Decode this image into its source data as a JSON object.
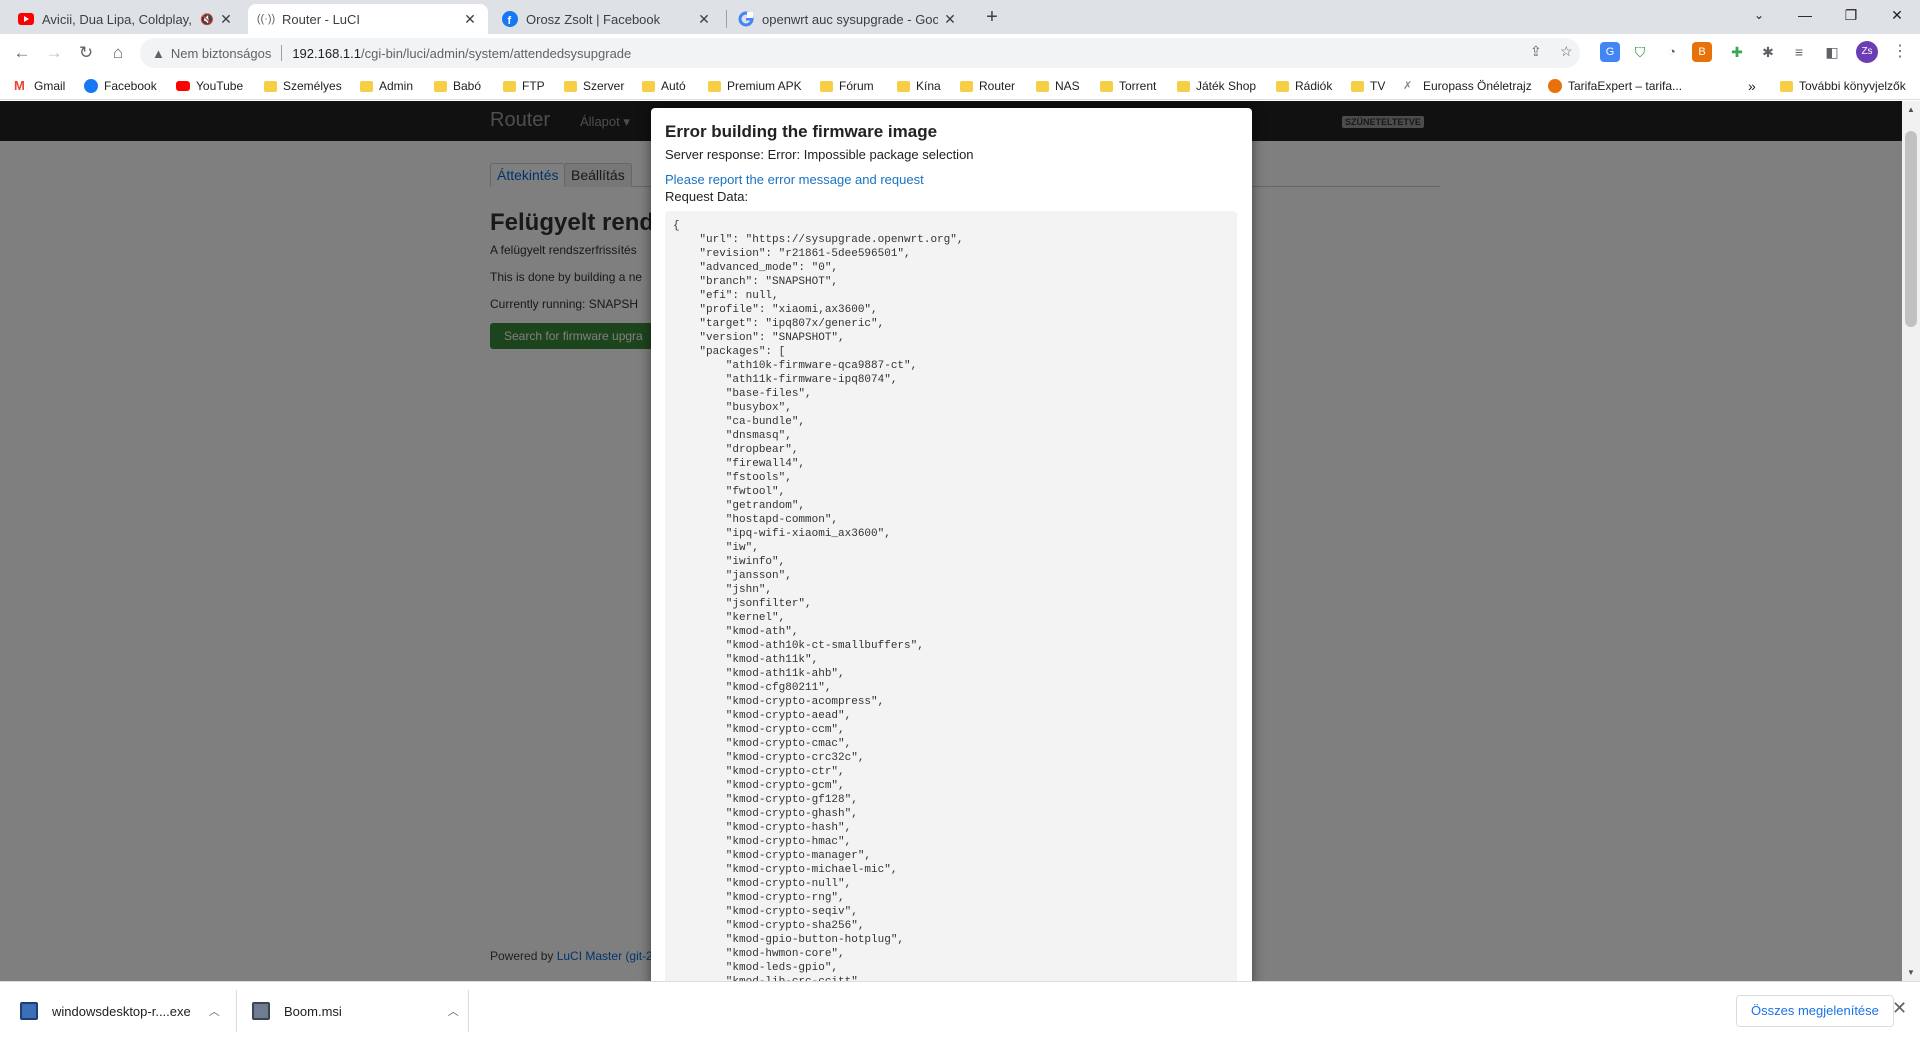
{
  "tabs": [
    {
      "title": "Avicii, Dua Lipa, Coldplay, Ma",
      "favicon": "youtube-icon",
      "muted": true
    },
    {
      "title": "Router - LuCI",
      "favicon": "radio-signal-icon",
      "active": true
    },
    {
      "title": "Orosz Zsolt | Facebook",
      "favicon": "facebook-icon"
    },
    {
      "title": "openwrt auc sysupgrade - Googl",
      "favicon": "google-icon"
    }
  ],
  "address": {
    "security_label": "Nem biztonságos",
    "url_host": "192.168.1.1",
    "url_path": "/cgi-bin/luci/admin/system/attendedsysupgrade"
  },
  "profile": {
    "initials": "Zs"
  },
  "bookmarks": [
    {
      "label": "Gmail",
      "icon": "gmail-icon"
    },
    {
      "label": "Facebook",
      "icon": "facebook-icon"
    },
    {
      "label": "YouTube",
      "icon": "youtube-icon"
    },
    {
      "label": "Személyes",
      "icon": "folder-icon"
    },
    {
      "label": "Admin",
      "icon": "folder-icon"
    },
    {
      "label": "Babó",
      "icon": "folder-icon"
    },
    {
      "label": "FTP",
      "icon": "folder-icon"
    },
    {
      "label": "Szerver",
      "icon": "folder-icon"
    },
    {
      "label": "Autó",
      "icon": "folder-icon"
    },
    {
      "label": "Premium APK",
      "icon": "folder-icon"
    },
    {
      "label": "Fórum",
      "icon": "folder-icon"
    },
    {
      "label": "Kína",
      "icon": "folder-icon"
    },
    {
      "label": "Router",
      "icon": "folder-icon"
    },
    {
      "label": "NAS",
      "icon": "folder-icon"
    },
    {
      "label": "Torrent",
      "icon": "folder-icon"
    },
    {
      "label": "Játék Shop",
      "icon": "folder-icon"
    },
    {
      "label": "Rádiók",
      "icon": "folder-icon"
    },
    {
      "label": "TV",
      "icon": "folder-icon"
    },
    {
      "label": "Europass Önéletrajz",
      "icon": "europass-icon"
    },
    {
      "label": "TarifaExpert – tarifa...",
      "icon": "tarifaexpert-icon"
    }
  ],
  "bookmarks_more": "»",
  "other_bookmarks": "További könyvjelzők",
  "luci": {
    "brand": "Router",
    "menu_status": "Állapot",
    "badge": "SZÜNETELTETVE",
    "tab_overview": "Áttekintés",
    "tab_settings": "Beállítás",
    "title": "Felügyelt rend",
    "desc1": "A felügyelt rendszerfrissítés",
    "desc2": "This is done by building a ne",
    "desc3": "Currently running: SNAPSH",
    "search_button": "Search for firmware upgra",
    "footer_prefix": "Powered by ",
    "footer_link": "LuCI Master (git-2"
  },
  "modal": {
    "title": "Error building the firmware image",
    "server_response": "Server response: Error: Impossible package selection",
    "report_link": "Please report the error message and request",
    "request_label": "Request Data:",
    "request_json": "{\n    \"url\": \"https://sysupgrade.openwrt.org\",\n    \"revision\": \"r21861-5dee596501\",\n    \"advanced_mode\": \"0\",\n    \"branch\": \"SNAPSHOT\",\n    \"efi\": null,\n    \"profile\": \"xiaomi,ax3600\",\n    \"target\": \"ipq807x/generic\",\n    \"version\": \"SNAPSHOT\",\n    \"packages\": [\n        \"ath10k-firmware-qca9887-ct\",\n        \"ath11k-firmware-ipq8074\",\n        \"base-files\",\n        \"busybox\",\n        \"ca-bundle\",\n        \"dnsmasq\",\n        \"dropbear\",\n        \"firewall4\",\n        \"fstools\",\n        \"fwtool\",\n        \"getrandom\",\n        \"hostapd-common\",\n        \"ipq-wifi-xiaomi_ax3600\",\n        \"iw\",\n        \"iwinfo\",\n        \"jansson\",\n        \"jshn\",\n        \"jsonfilter\",\n        \"kernel\",\n        \"kmod-ath\",\n        \"kmod-ath10k-ct-smallbuffers\",\n        \"kmod-ath11k\",\n        \"kmod-ath11k-ahb\",\n        \"kmod-cfg80211\",\n        \"kmod-crypto-acompress\",\n        \"kmod-crypto-aead\",\n        \"kmod-crypto-ccm\",\n        \"kmod-crypto-cmac\",\n        \"kmod-crypto-crc32c\",\n        \"kmod-crypto-ctr\",\n        \"kmod-crypto-gcm\",\n        \"kmod-crypto-gf128\",\n        \"kmod-crypto-ghash\",\n        \"kmod-crypto-hash\",\n        \"kmod-crypto-hmac\",\n        \"kmod-crypto-manager\",\n        \"kmod-crypto-michael-mic\",\n        \"kmod-crypto-null\",\n        \"kmod-crypto-rng\",\n        \"kmod-crypto-seqiv\",\n        \"kmod-crypto-sha256\",\n        \"kmod-gpio-button-hotplug\",\n        \"kmod-hwmon-core\",\n        \"kmod-leds-gpio\",\n        \"kmod-lib-crc-ccitt\","
  },
  "downloads": [
    {
      "name": "windowsdesktop-r....exe",
      "icon": "installer-icon"
    },
    {
      "name": "Boom.msi",
      "icon": "msi-icon"
    }
  ],
  "downloads_show_all": "Összes megjelenítése",
  "colors": {
    "luci_header": "#222222",
    "luci_button": "#3a8a3a",
    "link": "#1a73c4",
    "overlay": "rgba(0,0,0,0.5)"
  }
}
